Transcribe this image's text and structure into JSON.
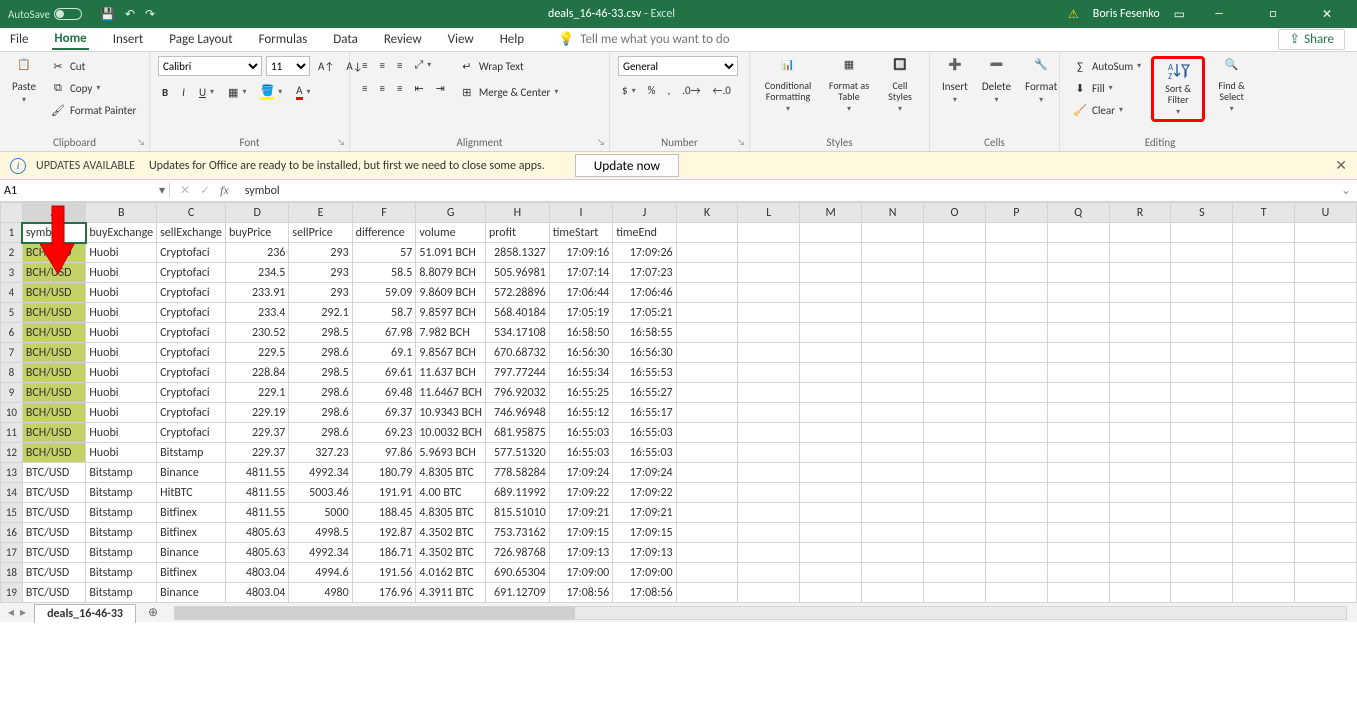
{
  "titlebar": {
    "autosave_label": "AutoSave",
    "autosave_state": "Off",
    "filename": "deals_16-46-33.csv",
    "appname": "Excel",
    "username": "Boris Fesenko"
  },
  "tabs": {
    "file": "File",
    "home": "Home",
    "insert": "Insert",
    "pagelayout": "Page Layout",
    "formulas": "Formulas",
    "data": "Data",
    "review": "Review",
    "view": "View",
    "help": "Help",
    "tell_placeholder": "Tell me what you want to do",
    "share": "Share"
  },
  "ribbon": {
    "clipboard": {
      "paste": "Paste",
      "cut": "Cut",
      "copy": "Copy",
      "format_painter": "Format Painter",
      "label": "Clipboard"
    },
    "font": {
      "name": "Calibri",
      "size": "11",
      "label": "Font"
    },
    "alignment": {
      "wrap": "Wrap Text",
      "merge": "Merge & Center",
      "label": "Alignment"
    },
    "number": {
      "format": "General",
      "label": "Number"
    },
    "styles": {
      "conditional": "Conditional Formatting",
      "format_as_table": "Format as Table",
      "cell_styles": "Cell Styles",
      "label": "Styles"
    },
    "cells": {
      "insert": "Insert",
      "delete": "Delete",
      "format": "Format",
      "label": "Cells"
    },
    "editing": {
      "autosum": "AutoSum",
      "fill": "Fill",
      "clear": "Clear",
      "sortfilter": "Sort & Filter",
      "find": "Find & Select",
      "label": "Editing"
    }
  },
  "infobar": {
    "title": "UPDATES AVAILABLE",
    "msg": "Updates for Office are ready to be installed, but first we need to close some apps.",
    "btn": "Update now"
  },
  "formula_bar": {
    "name_box": "A1",
    "formula": "symbol"
  },
  "columns": [
    "A",
    "B",
    "C",
    "D",
    "E",
    "F",
    "G",
    "H",
    "I",
    "J",
    "K",
    "L",
    "M",
    "N",
    "O",
    "P",
    "Q",
    "R",
    "S",
    "T",
    "U"
  ],
  "headers": [
    "symbol",
    "buyExchange",
    "sellExchange",
    "buyPrice",
    "sellPrice",
    "difference",
    "volume",
    "profit",
    "timeStart",
    "timeEnd"
  ],
  "rows": [
    {
      "symbol": "BCH/USD",
      "buy": "Huobi",
      "sell": "Cryptofacilities",
      "bp": "236",
      "sp": "293",
      "diff": "57",
      "vol": "51.091 BCH",
      "profit": "2858.1327",
      "ts": "17:09:16",
      "te": "17:09:26",
      "hl": true
    },
    {
      "symbol": "BCH/USD",
      "buy": "Huobi",
      "sell": "Cryptofacilities",
      "bp": "234.5",
      "sp": "293",
      "diff": "58.5",
      "vol": "8.8079 BCH",
      "profit": "505.96981",
      "ts": "17:07:14",
      "te": "17:07:23",
      "hl": true
    },
    {
      "symbol": "BCH/USD",
      "buy": "Huobi",
      "sell": "Cryptofacilities",
      "bp": "233.91",
      "sp": "293",
      "diff": "59.09",
      "vol": "9.8609 BCH",
      "profit": "572.28896",
      "ts": "17:06:44",
      "te": "17:06:46",
      "hl": true
    },
    {
      "symbol": "BCH/USD",
      "buy": "Huobi",
      "sell": "Cryptofacilities",
      "bp": "233.4",
      "sp": "292.1",
      "diff": "58.7",
      "vol": "9.8597 BCH",
      "profit": "568.40184",
      "ts": "17:05:19",
      "te": "17:05:21",
      "hl": true
    },
    {
      "symbol": "BCH/USD",
      "buy": "Huobi",
      "sell": "Cryptofacilities",
      "bp": "230.52",
      "sp": "298.5",
      "diff": "67.98",
      "vol": "7.982 BCH",
      "profit": "534.17108",
      "ts": "16:58:50",
      "te": "16:58:55",
      "hl": true
    },
    {
      "symbol": "BCH/USD",
      "buy": "Huobi",
      "sell": "Cryptofacilities",
      "bp": "229.5",
      "sp": "298.6",
      "diff": "69.1",
      "vol": "9.8567 BCH",
      "profit": "670.68732",
      "ts": "16:56:30",
      "te": "16:56:30",
      "hl": true
    },
    {
      "symbol": "BCH/USD",
      "buy": "Huobi",
      "sell": "Cryptofacilities",
      "bp": "228.84",
      "sp": "298.5",
      "diff": "69.61",
      "vol": "11.637 BCH",
      "profit": "797.77244",
      "ts": "16:55:34",
      "te": "16:55:53",
      "hl": true
    },
    {
      "symbol": "BCH/USD",
      "buy": "Huobi",
      "sell": "Cryptofacilities",
      "bp": "229.1",
      "sp": "298.6",
      "diff": "69.48",
      "vol": "11.6467 BCH",
      "profit": "796.92032",
      "ts": "16:55:25",
      "te": "16:55:27",
      "hl": true
    },
    {
      "symbol": "BCH/USD",
      "buy": "Huobi",
      "sell": "Cryptofacilities",
      "bp": "229.19",
      "sp": "298.6",
      "diff": "69.37",
      "vol": "10.9343 BCH",
      "profit": "746.96948",
      "ts": "16:55:12",
      "te": "16:55:17",
      "hl": true
    },
    {
      "symbol": "BCH/USD",
      "buy": "Huobi",
      "sell": "Cryptofacilities",
      "bp": "229.37",
      "sp": "298.6",
      "diff": "69.23",
      "vol": "10.0032 BCH",
      "profit": "681.95875",
      "ts": "16:55:03",
      "te": "16:55:03",
      "hl": true
    },
    {
      "symbol": "BCH/USD",
      "buy": "Huobi",
      "sell": "Bitstamp",
      "bp": "229.37",
      "sp": "327.23",
      "diff": "97.86",
      "vol": "5.9693 BCH",
      "profit": "577.51320",
      "ts": "16:55:03",
      "te": "16:55:03",
      "hl": true
    },
    {
      "symbol": "BTC/USD",
      "buy": "Bitstamp",
      "sell": "Binance",
      "bp": "4811.55",
      "sp": "4992.34",
      "diff": "180.79",
      "vol": "4.8305 BTC",
      "profit": "778.58284",
      "ts": "17:09:24",
      "te": "17:09:24",
      "hl": false
    },
    {
      "symbol": "BTC/USD",
      "buy": "Bitstamp",
      "sell": "HitBTC",
      "bp": "4811.55",
      "sp": "5003.46",
      "diff": "191.91",
      "vol": "4.00 BTC",
      "profit": "689.11992",
      "ts": "17:09:22",
      "te": "17:09:22",
      "hl": false
    },
    {
      "symbol": "BTC/USD",
      "buy": "Bitstamp",
      "sell": "Bitfinex",
      "bp": "4811.55",
      "sp": "5000",
      "diff": "188.45",
      "vol": "4.8305 BTC",
      "profit": "815.51010",
      "ts": "17:09:21",
      "te": "17:09:21",
      "hl": false
    },
    {
      "symbol": "BTC/USD",
      "buy": "Bitstamp",
      "sell": "Bitfinex",
      "bp": "4805.63",
      "sp": "4998.5",
      "diff": "192.87",
      "vol": "4.3502 BTC",
      "profit": "753.73162",
      "ts": "17:09:15",
      "te": "17:09:15",
      "hl": false
    },
    {
      "symbol": "BTC/USD",
      "buy": "Bitstamp",
      "sell": "Binance",
      "bp": "4805.63",
      "sp": "4992.34",
      "diff": "186.71",
      "vol": "4.3502 BTC",
      "profit": "726.98768",
      "ts": "17:09:13",
      "te": "17:09:13",
      "hl": false
    },
    {
      "symbol": "BTC/USD",
      "buy": "Bitstamp",
      "sell": "Bitfinex",
      "bp": "4803.04",
      "sp": "4994.6",
      "diff": "191.56",
      "vol": "4.0162 BTC",
      "profit": "690.65304",
      "ts": "17:09:00",
      "te": "17:09:00",
      "hl": false
    },
    {
      "symbol": "BTC/USD",
      "buy": "Bitstamp",
      "sell": "Binance",
      "bp": "4803.04",
      "sp": "4980",
      "diff": "176.96",
      "vol": "4.3911 BTC",
      "profit": "691.12709",
      "ts": "17:08:56",
      "te": "17:08:56",
      "hl": false
    }
  ],
  "sheet": {
    "name": "deals_16-46-33"
  }
}
